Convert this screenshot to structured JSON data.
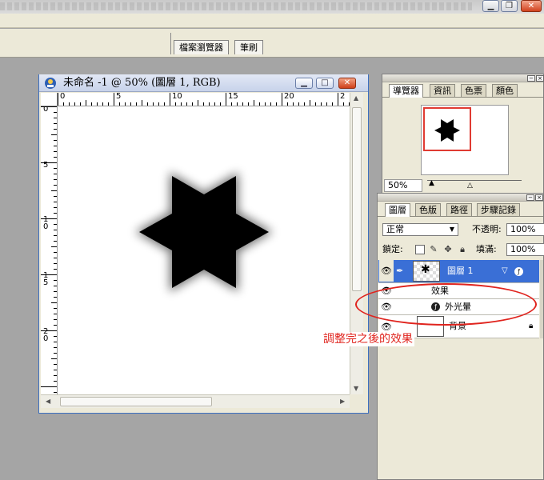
{
  "app": {
    "panel_well_tabs": [
      "檔案瀏覽器",
      "筆刷"
    ]
  },
  "document": {
    "title": "未命名 -1 @ 50% (圖層 1, RGB)",
    "ruler_h_labels": [
      "0",
      "5",
      "10",
      "15",
      "20",
      "2"
    ],
    "ruler_v_labels": [
      "0",
      "5",
      "1\n0",
      "1\n5",
      "2\n0"
    ],
    "shape": "six-point-star"
  },
  "navigator_palette": {
    "tabs": [
      "導覽器",
      "資訊",
      "色票",
      "顏色"
    ],
    "active_tab": "導覽器",
    "zoom": "50%"
  },
  "layers_palette": {
    "tabs": [
      "圖層",
      "色版",
      "路徑",
      "步驟記錄"
    ],
    "active_tab": "圖層",
    "blend_mode": "正常",
    "opacity_label": "不透明:",
    "opacity_value": "100%",
    "lock_label": "鎖定:",
    "fill_label": "填滿:",
    "fill_value": "100%",
    "layers": [
      {
        "name": "圖層 1",
        "selected": true
      },
      {
        "effects_label": "效果",
        "effect_name": "外光暈"
      },
      {
        "name": "背景",
        "locked": true
      }
    ]
  },
  "annotation": {
    "text": "調整完之後的效果",
    "color": "#e0241e"
  },
  "colors": {
    "selection": "#3a6fd6",
    "workspace": "#a5a5a5",
    "panel": "#ece9d8"
  }
}
